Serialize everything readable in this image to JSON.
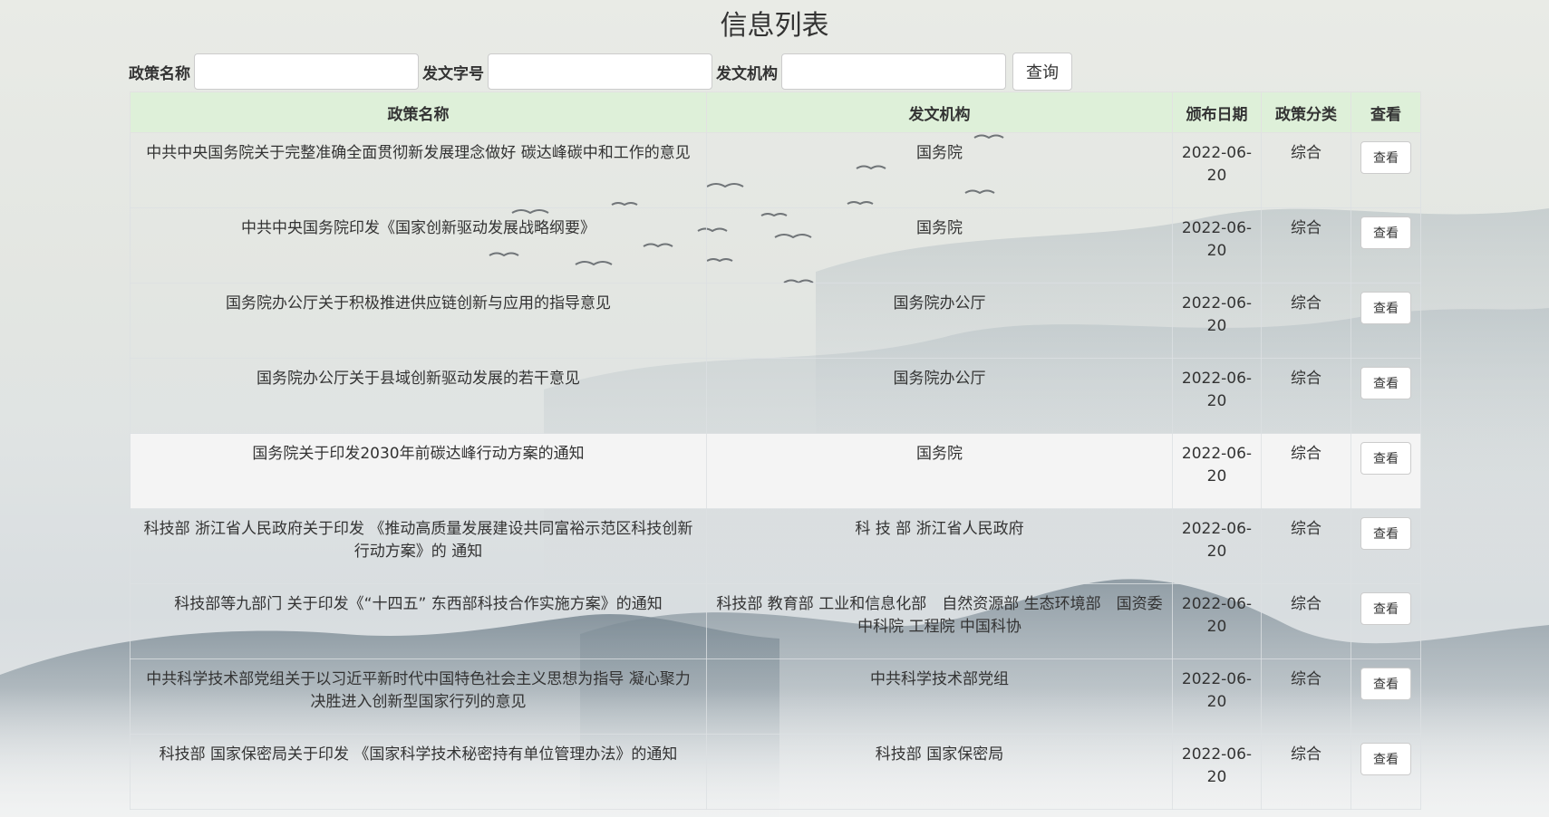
{
  "page": {
    "title": "信息列表"
  },
  "search": {
    "policy_name_label": "政策名称",
    "doc_number_label": "发文字号",
    "issuer_label": "发文机构",
    "policy_name_value": "",
    "doc_number_value": "",
    "issuer_value": "",
    "submit_label": "查询"
  },
  "table": {
    "columns": [
      "政策名称",
      "发文机构",
      "颁布日期",
      "政策分类",
      "查看"
    ],
    "rows": [
      {
        "name": "中共中央国务院关于完整准确全面贯彻新发展理念做好 碳达峰碳中和工作的意见",
        "issuer": "国务院",
        "date": "2022-06-20",
        "category": "综合",
        "action": "查看"
      },
      {
        "name": "中共中央国务院印发《国家创新驱动发展战略纲要》",
        "issuer": "国务院",
        "date": "2022-06-20",
        "category": "综合",
        "action": "查看"
      },
      {
        "name": "国务院办公厅关于积极推进供应链创新与应用的指导意见",
        "issuer": "国务院办公厅",
        "date": "2022-06-20",
        "category": "综合",
        "action": "查看"
      },
      {
        "name": "国务院办公厅关于县域创新驱动发展的若干意见",
        "issuer": "国务院办公厅",
        "date": "2022-06-20",
        "category": "综合",
        "action": "查看"
      },
      {
        "name": "国务院关于印发2030年前碳达峰行动方案的通知",
        "issuer": "国务院",
        "date": "2022-06-20",
        "category": "综合",
        "action": "查看"
      },
      {
        "name": "科技部 浙江省人民政府关于印发 《推动高质量发展建设共同富裕示范区科技创新行动方案》的 通知",
        "issuer": "科 技 部 浙江省人民政府",
        "date": "2022-06-20",
        "category": "综合",
        "action": "查看"
      },
      {
        "name": "科技部等九部门 关于印发《“十四五” 东西部科技合作实施方案》的通知",
        "issuer": "科技部 教育部 工业和信息化部　自然资源部 生态环境部　国资委 中科院 工程院 中国科协",
        "date": "2022-06-20",
        "category": "综合",
        "action": "查看"
      },
      {
        "name": "中共科学技术部党组关于以习近平新时代中国特色社会主义思想为指导 凝心聚力 决胜进入创新型国家行列的意见",
        "issuer": "中共科学技术部党组",
        "date": "2022-06-20",
        "category": "综合",
        "action": "查看"
      },
      {
        "name": "科技部 国家保密局关于印发 《国家科学技术秘密持有单位管理办法》的通知",
        "issuer": "科技部 国家保密局",
        "date": "2022-06-20",
        "category": "综合",
        "action": "查看"
      }
    ]
  },
  "theme": {
    "header_bg": "#ddf0d8",
    "highlight_row_bg": "#f5f5f5",
    "text_color": "#333333"
  }
}
